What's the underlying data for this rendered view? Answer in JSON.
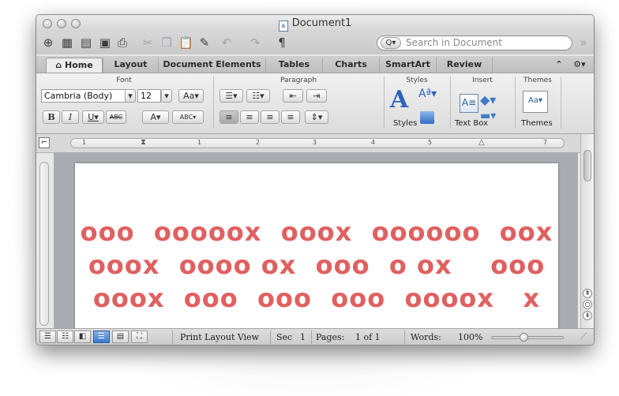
{
  "window": {
    "title": "Document1"
  },
  "search": {
    "placeholder": "Search in Document"
  },
  "ribbon_tabs": [
    "Home",
    "Layout",
    "Document Elements",
    "Tables",
    "Charts",
    "SmartArt",
    "Review"
  ],
  "groups": {
    "font": "Font",
    "paragraph": "Paragraph",
    "styles": "Styles",
    "insert": "Insert",
    "themes": "Themes"
  },
  "font": {
    "name": "Cambria (Body)",
    "size": "12"
  },
  "styles_button": "Styles",
  "text_box_button": "Text Box",
  "themes_button": "Themes",
  "ruler_numbers": [
    "1",
    "1",
    "2",
    "3",
    "4",
    "5",
    "6",
    "7"
  ],
  "document_art_lines": [
    "ooo  ooooox  ooox  oooooo  oox",
    "ooox  oooo ox  ooo  o ox    ooo",
    "ooox  ooo  ooo  ooo  oooox   x"
  ],
  "status": {
    "view": "Print Layout View",
    "sec_label": "Sec",
    "sec_value": "1",
    "pages_label": "Pages:",
    "pages_value": "1 of 1",
    "words_label": "Words:",
    "zoom": "100%"
  },
  "colors": {
    "art": "#e06060",
    "active_view": "#3d79c9"
  }
}
